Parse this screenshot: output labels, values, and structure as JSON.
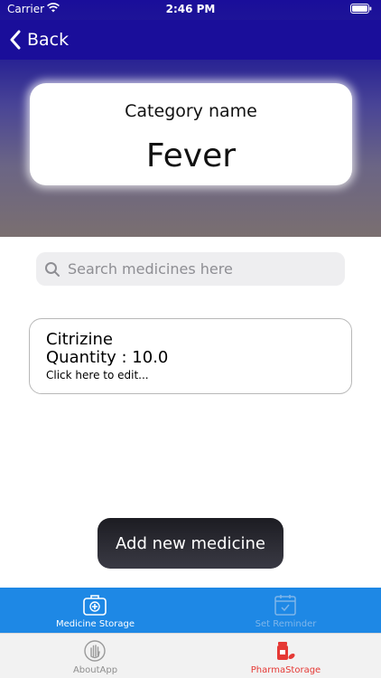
{
  "status_bar": {
    "carrier": "Carrier",
    "time": "2:46 PM"
  },
  "nav": {
    "back_label": "Back"
  },
  "category": {
    "label": "Category name",
    "value": "Fever"
  },
  "search": {
    "placeholder": "Search medicines here",
    "value": ""
  },
  "medicines": [
    {
      "name": "Citrizine",
      "quantity": "Quantity : 10.0",
      "edit_hint": "Click here to edit..."
    }
  ],
  "add_button": {
    "label": "Add new medicine"
  },
  "tabbar_top": {
    "items": [
      {
        "label": "Medicine Storage",
        "icon": "medical-kit-icon",
        "active": true
      },
      {
        "label": "Set Reminder",
        "icon": "calendar-check-icon",
        "active": false
      }
    ]
  },
  "tabbar_bottom": {
    "items": [
      {
        "label": "AboutApp",
        "icon": "hand-icon",
        "active": false
      },
      {
        "label": "PharmaStorage",
        "icon": "pills-icon",
        "active": true
      }
    ]
  },
  "colors": {
    "nav_blue": "#1a0e9a",
    "tab_blue": "#1e88e5",
    "active_red": "#e53935",
    "inactive_gray": "#8e8e8e"
  }
}
